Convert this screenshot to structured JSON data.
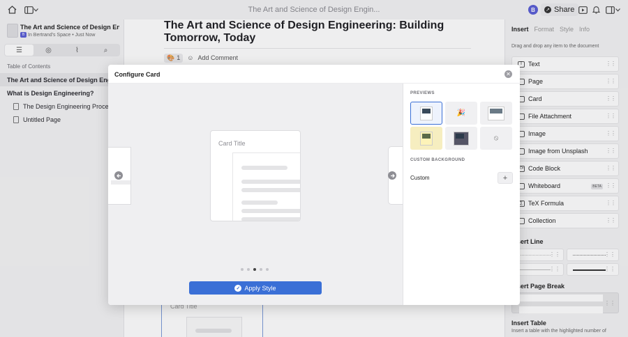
{
  "topbar": {
    "title": "The Art and Science of Design Engin...",
    "avatar_initial": "B",
    "share_label": "Share",
    "icons": [
      "home-icon",
      "sidebar-toggle-icon",
      "chevron-down-icon",
      "present-icon",
      "bell-icon",
      "layout-icon",
      "chevron-down-icon"
    ]
  },
  "sidebar": {
    "space_name": "The Art and Science of Design Engine...",
    "space_sub": "In Bertrand's Space • Just Now",
    "toc_label": "Table of Contents",
    "items": [
      {
        "label": "The Art and Science of Design Engineering"
      },
      {
        "label": "What is Design Engineering?"
      },
      {
        "label": "The Design Engineering Process"
      },
      {
        "label": "Untitled Page"
      }
    ]
  },
  "document": {
    "heading": "The Art and Science of Design Engineering: Building Tomorrow, Today",
    "reaction_count": "1",
    "add_comment": "Add Comment",
    "card_title_below": "Card Title"
  },
  "right_panel": {
    "tabs": [
      "Insert",
      "Format",
      "Style",
      "Info"
    ],
    "hint": "Drag and drop any item to the document",
    "items": [
      {
        "label": "Text"
      },
      {
        "label": "Page"
      },
      {
        "label": "Card"
      },
      {
        "label": "File Attachment"
      },
      {
        "label": "Image"
      },
      {
        "label": "Image from Unsplash"
      },
      {
        "label": "Code Block"
      },
      {
        "label": "Whiteboard",
        "badge": "BETA"
      },
      {
        "label": "TeX Formula"
      },
      {
        "label": "Collection"
      }
    ],
    "insert_line": "Insert Line",
    "insert_page_break": "Insert Page Break",
    "insert_table": "Insert Table",
    "insert_table_sub": "Insert a table with the highlighted number of"
  },
  "modal": {
    "title": "Configure Card",
    "card_title": "Card Title",
    "apply_label": "Apply Style",
    "previews_label": "PREVIEWS",
    "custom_bg_label": "CUSTOM BACKGROUND",
    "custom_label": "Custom",
    "carousel_pages": 5,
    "carousel_active_index": 2
  }
}
